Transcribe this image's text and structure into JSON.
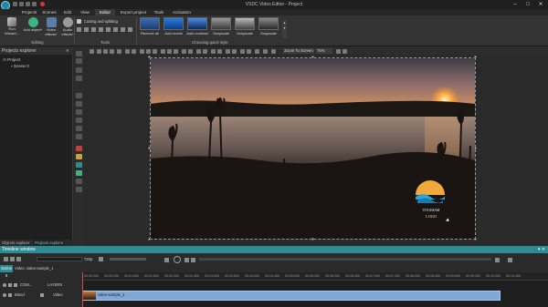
{
  "window": {
    "title": "VSDC Video Editor - Project",
    "controls": [
      "–",
      "□",
      "✕"
    ]
  },
  "menu": {
    "tabs": [
      "Projects",
      "Scenes",
      "Edit",
      "View",
      "Editor",
      "Export project",
      "Tools",
      "Activation"
    ],
    "active": "Editor"
  },
  "ribbon": {
    "run_wizard": "Run Wizard...",
    "add_object": "Add object*",
    "video_effects": "Video effects*",
    "audio_effects": "Audio effects*",
    "editing_label": "Editing",
    "cutting": "Cutting and splitting",
    "tools_label": "Tools",
    "quick_styles": [
      "Remove all",
      "Auto levels",
      "Auto contrast",
      "Grayscale",
      "Grayscale",
      "Grayscale"
    ],
    "quick_style_label": "Choosing quick style"
  },
  "projects_explorer": {
    "header": "Projects explorer",
    "tree": [
      {
        "label": "Project"
      },
      {
        "label": "Scene 0"
      }
    ],
    "bottom_tabs": [
      "Objects explorer",
      "Projects explorer"
    ],
    "active_tab": "Projects explorer"
  },
  "canvas": {
    "zoom_label": "Zoom To Screen",
    "zoom_value": "75%"
  },
  "preview": {
    "logo_text_line1": "TOURISM",
    "logo_text_line2": "LOGO"
  },
  "timeline": {
    "title": "Timeline window",
    "window_buttons": "▾ ✕",
    "resolution": "720p",
    "scene_tab": "Scene 0",
    "path": "Video: video-sample_1",
    "ticks": [
      "00:00:000",
      "00:00:200",
      "00:01:000",
      "00:01:600",
      "00:02:000",
      "00:02:400",
      "00:03:000",
      "00:03:600",
      "00:04:000",
      "00:04:400",
      "00:05:000",
      "00:05:400",
      "00:06:000",
      "00:06:400",
      "00:07:000",
      "00:07:400",
      "00:08:000",
      "00:08:400",
      "00:09:000",
      "00:09:400",
      "00:10:000",
      "00:10:400"
    ],
    "track1": {
      "com_label": "COM...",
      "layers_label": "LAYERS"
    },
    "track2": {
      "blend": "Blend",
      "type": "Video"
    },
    "clip_label": "video-sample_1"
  },
  "colors": {
    "accent": "#2f8b93",
    "clip": "#7fa8d8",
    "playhead": "#e04848"
  }
}
